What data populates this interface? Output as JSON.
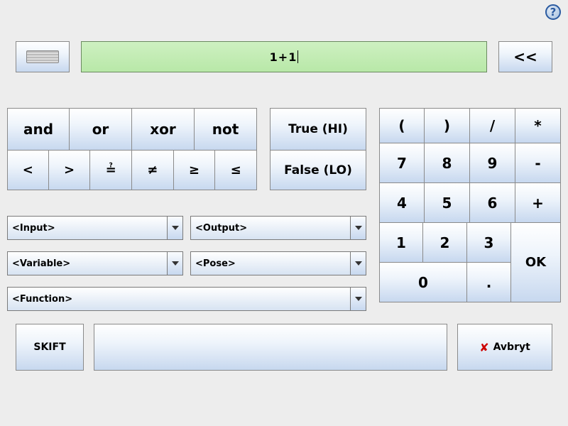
{
  "help_glyph": "?",
  "expression": "1+1",
  "backspace_label": "<<",
  "logic_row1": {
    "and": "and",
    "or": "or",
    "xor": "xor",
    "not": "not"
  },
  "logic_row2": {
    "lt": "<",
    "gt": ">",
    "eqq": "≟",
    "ne": "≠",
    "ge": "≥",
    "le": "≤"
  },
  "bool": {
    "true": "True (HI)",
    "false": "False (LO)"
  },
  "dropdowns": {
    "input": "<Input>",
    "output": "<Output>",
    "variable": "<Variable>",
    "pose": "<Pose>",
    "function": "<Function>"
  },
  "numpad": {
    "lparen": "(",
    "rparen": ")",
    "div": "/",
    "mul": "*",
    "k7": "7",
    "k8": "8",
    "k9": "9",
    "minus": "-",
    "k4": "4",
    "k5": "5",
    "k6": "6",
    "plus": "+",
    "k1": "1",
    "k2": "2",
    "k3": "3",
    "k0": "0",
    "dot": ".",
    "ok": "OK"
  },
  "bottom": {
    "shift": "SKIFT",
    "cancel": "Avbryt",
    "cancel_icon": "✘"
  }
}
